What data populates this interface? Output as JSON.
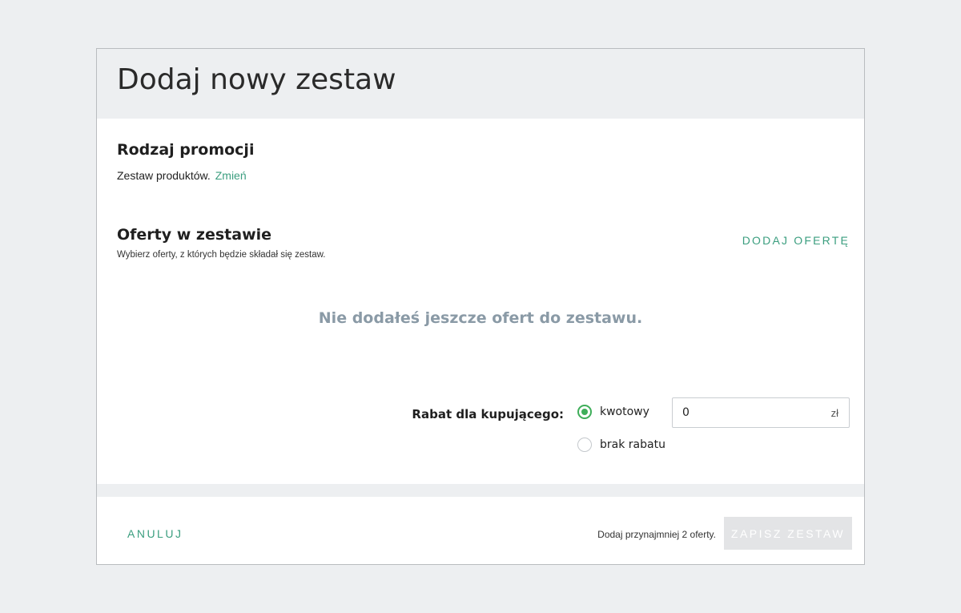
{
  "dialog": {
    "title": "Dodaj nowy zestaw"
  },
  "promotion": {
    "title": "Rodzaj promocji",
    "type_text": "Zestaw produktów.",
    "change_link": "Zmień"
  },
  "offers": {
    "title": "Oferty w zestawie",
    "subtitle": "Wybierz oferty, z których będzie składał się zestaw.",
    "add_button": "DODAJ OFERTĘ",
    "empty_message": "Nie dodałeś jeszcze ofert do zestawu."
  },
  "discount": {
    "label": "Rabat dla kupującego:",
    "options": [
      {
        "label": "kwotowy",
        "selected": true
      },
      {
        "label": "brak rabatu",
        "selected": false
      }
    ],
    "amount_value": "0",
    "currency": "zł"
  },
  "footer": {
    "cancel_label": "ANULUJ",
    "hint": "Dodaj przynajmniej 2 oferty.",
    "save_label": "ZAPISZ ZESTAW"
  },
  "colors": {
    "accent": "#3b9e7f",
    "radio_selected": "#3fae5a",
    "empty_text": "#8a9aa6",
    "disabled_button": "#e3e4e6",
    "background": "#edeff1"
  }
}
